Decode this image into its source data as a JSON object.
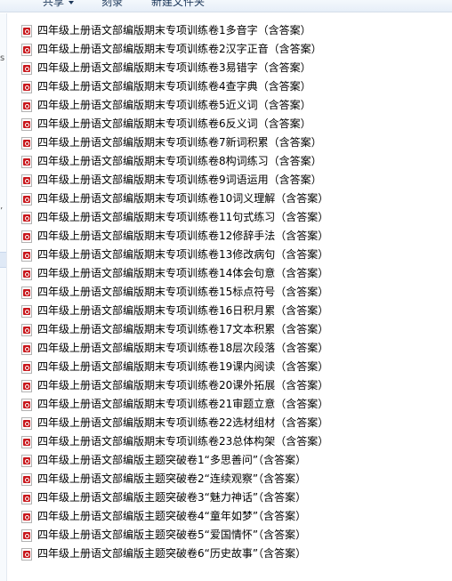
{
  "toolbar": {
    "share_label": "共享",
    "burn_label": "刻录",
    "new_folder_label": "新建文件夹"
  },
  "navigation": {
    "marks": [
      "s",
      "’"
    ]
  },
  "files": [
    {
      "name": "四年级上册语文部编版期末专项训练卷1多音字（含答案）",
      "icon": "pdf-icon"
    },
    {
      "name": "四年级上册语文部编版期末专项训练卷2汉字正音（含答案）",
      "icon": "pdf-icon"
    },
    {
      "name": "四年级上册语文部编版期末专项训练卷3易错字（含答案）",
      "icon": "pdf-icon"
    },
    {
      "name": "四年级上册语文部编版期末专项训练卷4查字典（含答案）",
      "icon": "pdf-icon"
    },
    {
      "name": "四年级上册语文部编版期末专项训练卷5近义词（含答案）",
      "icon": "pdf-icon"
    },
    {
      "name": "四年级上册语文部编版期末专项训练卷6反义词（含答案）",
      "icon": "pdf-icon"
    },
    {
      "name": "四年级上册语文部编版期末专项训练卷7新词积累（含答案）",
      "icon": "pdf-icon"
    },
    {
      "name": "四年级上册语文部编版期末专项训练卷8构词练习（含答案）",
      "icon": "pdf-icon"
    },
    {
      "name": "四年级上册语文部编版期末专项训练卷9词语运用（含答案）",
      "icon": "pdf-icon"
    },
    {
      "name": "四年级上册语文部编版期末专项训练卷10词义理解（含答案）",
      "icon": "pdf-icon"
    },
    {
      "name": "四年级上册语文部编版期末专项训练卷11句式练习（含答案）",
      "icon": "pdf-icon"
    },
    {
      "name": "四年级上册语文部编版期末专项训练卷12修辞手法（含答案）",
      "icon": "pdf-icon"
    },
    {
      "name": "四年级上册语文部编版期末专项训练卷13修改病句（含答案）",
      "icon": "pdf-icon"
    },
    {
      "name": "四年级上册语文部编版期末专项训练卷14体会句意（含答案）",
      "icon": "pdf-icon"
    },
    {
      "name": "四年级上册语文部编版期末专项训练卷15标点符号（含答案）",
      "icon": "pdf-icon"
    },
    {
      "name": "四年级上册语文部编版期末专项训练卷16日积月累（含答案）",
      "icon": "pdf-icon"
    },
    {
      "name": "四年级上册语文部编版期末专项训练卷17文本积累（含答案）",
      "icon": "pdf-icon"
    },
    {
      "name": "四年级上册语文部编版期末专项训练卷18层次段落（含答案）",
      "icon": "pdf-icon"
    },
    {
      "name": "四年级上册语文部编版期末专项训练卷19课内阅读（含答案）",
      "icon": "pdf-icon"
    },
    {
      "name": "四年级上册语文部编版期末专项训练卷20课外拓展（含答案）",
      "icon": "pdf-icon"
    },
    {
      "name": "四年级上册语文部编版期末专项训练卷21审题立意（含答案）",
      "icon": "pdf-icon"
    },
    {
      "name": "四年级上册语文部编版期末专项训练卷22选材组材（含答案）",
      "icon": "pdf-icon"
    },
    {
      "name": "四年级上册语文部编版期末专项训练卷23总体构架（含答案）",
      "icon": "pdf-icon"
    },
    {
      "name": "四年级上册语文部编版主题突破卷1“多思善问”（含答案）",
      "icon": "pdf-icon"
    },
    {
      "name": "四年级上册语文部编版主题突破卷2“连续观察”（含答案）",
      "icon": "pdf-icon"
    },
    {
      "name": "四年级上册语文部编版主题突破卷3“魅力神话”（含答案）",
      "icon": "pdf-icon"
    },
    {
      "name": "四年级上册语文部编版主题突破卷4“童年如梦”（含答案）",
      "icon": "pdf-icon"
    },
    {
      "name": "四年级上册语文部编版主题突破卷5“爱国情怀”（含答案）",
      "icon": "pdf-icon"
    },
    {
      "name": "四年级上册语文部编版主题突破卷6“历史故事”（含答案）",
      "icon": "pdf-icon"
    }
  ]
}
